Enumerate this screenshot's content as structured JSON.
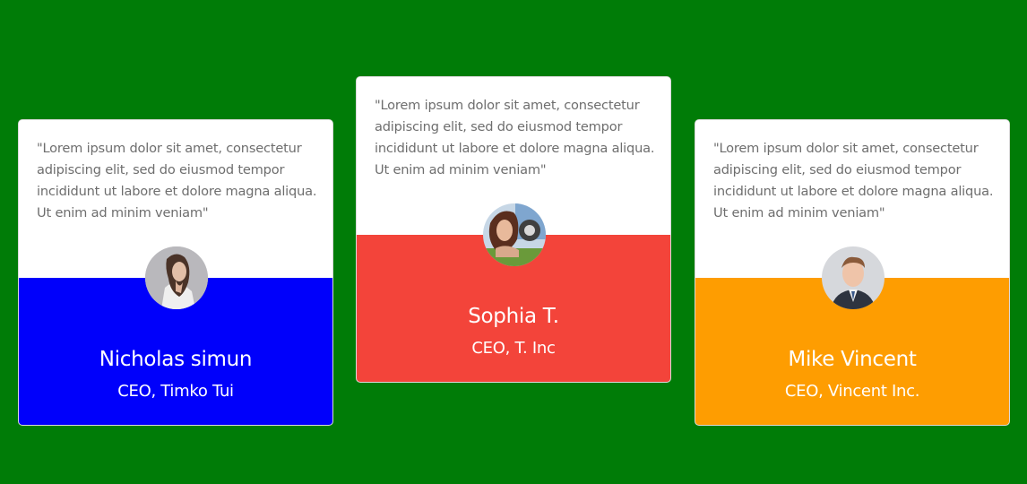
{
  "page": {
    "background_color": "#007c07"
  },
  "testimonials": [
    {
      "quote": "\"Lorem ipsum dolor sit amet, consectetur adipiscing elit, sed do eiusmod tempor incididunt ut labore et dolore magna aliqua. Ut enim ad minim veniam\"",
      "name": "Nicholas simun",
      "role": "CEO, Timko Tui",
      "accent_color": "#0000fb",
      "avatar": "woman-portrait-photo"
    },
    {
      "quote": "\"Lorem ipsum dolor sit amet, consectetur adipiscing elit, sed do eiusmod tempor incididunt ut labore et dolore magna aliqua. Ut enim ad minim veniam\"",
      "name": "Sophia T.",
      "role": "CEO, T. Inc",
      "accent_color": "#f3443a",
      "avatar": "woman-outdoor-portrait-photo"
    },
    {
      "quote": "\"Lorem ipsum dolor sit amet, consectetur adipiscing elit, sed do eiusmod tempor incididunt ut labore et dolore magna aliqua. Ut enim ad minim veniam\"",
      "name": "Mike Vincent",
      "role": "CEO, Vincent Inc.",
      "accent_color": "#fe9d01",
      "avatar": "man-suit-portrait-photo"
    }
  ]
}
